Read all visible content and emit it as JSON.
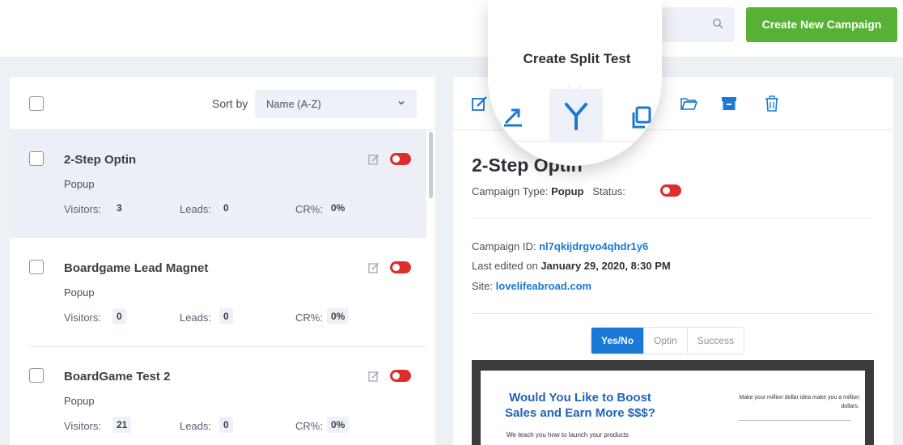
{
  "header": {
    "search_placeholder": "",
    "create_button": "Create New Campaign"
  },
  "list": {
    "sort_label": "Sort by",
    "sort_value": "Name (A-Z)",
    "items": [
      {
        "title": "2-Step Optin",
        "type": "Popup",
        "visitors_label": "Visitors:",
        "visitors": "3",
        "leads_label": "Leads:",
        "leads": "0",
        "cr_label": "CR%:",
        "cr": "0%",
        "selected": true
      },
      {
        "title": "Boardgame Lead Magnet",
        "type": "Popup",
        "visitors_label": "Visitors:",
        "visitors": "0",
        "leads_label": "Leads:",
        "leads": "0",
        "cr_label": "CR%:",
        "cr": "0%"
      },
      {
        "title": "BoardGame Test 2",
        "type": "Popup",
        "visitors_label": "Visitors:",
        "visitors": "21",
        "leads_label": "Leads:",
        "leads": "0",
        "cr_label": "CR%:",
        "cr": "0%"
      }
    ]
  },
  "detail": {
    "title": "2-Step Optin",
    "type_label": "Campaign Type:",
    "type_value": "Popup",
    "status_label": "Status:",
    "id_label": "Campaign ID:",
    "id_value": "nl7qkijdrgvo4qhdr1y6",
    "edited_label": "Last edited on",
    "edited_value": "January 29, 2020, 8:30 PM",
    "site_label": "Site:",
    "site_value": "lovelifeabroad.com",
    "tabs": [
      "Yes/No",
      "Optin",
      "Success"
    ],
    "active_tab": "Yes/No"
  },
  "preview": {
    "headline": "Would You Like to Boost Sales and Earn More $$$?",
    "right_text": "Make your million dollar idea make you a million dollars.",
    "subtext": "We teach you how to launch your products"
  },
  "magnifier": {
    "label": "Create Split Test"
  },
  "colors": {
    "accent_green": "#56b135",
    "link_blue": "#1a78d6",
    "toggle_red": "#dd2d2d"
  }
}
